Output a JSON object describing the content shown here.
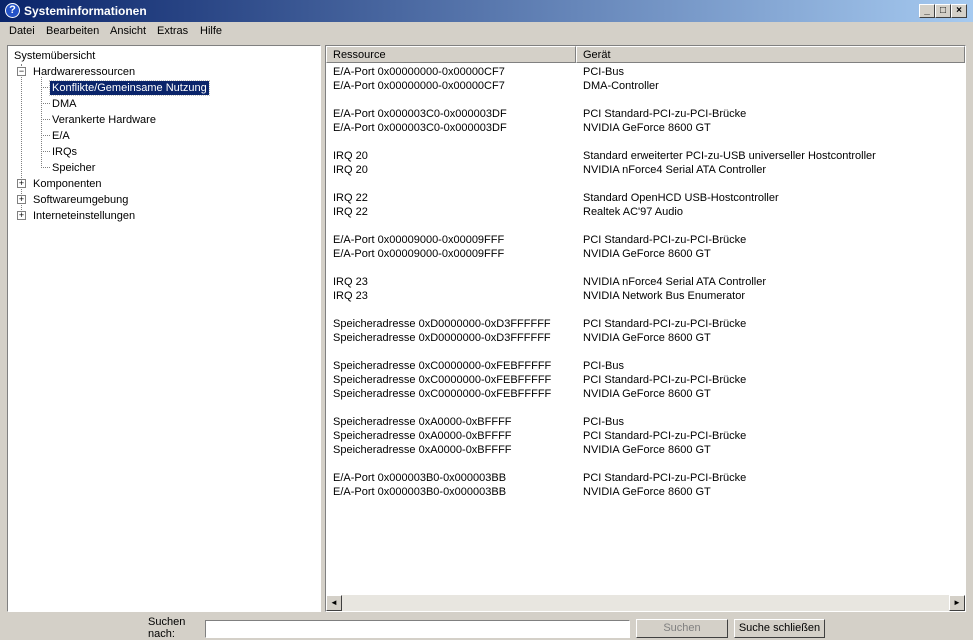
{
  "window": {
    "title": "Systeminformationen"
  },
  "window_buttons": [
    "_",
    "□",
    "×"
  ],
  "menu": [
    {
      "label": "Datei"
    },
    {
      "label": "Bearbeiten"
    },
    {
      "label": "Ansicht"
    },
    {
      "label": "Extras"
    },
    {
      "label": "Hilfe"
    }
  ],
  "tree": {
    "root": "Systemübersicht",
    "hardware": "Hardwareressourcen",
    "hardware_children": [
      "Konflikte/Gemeinsame Nutzung",
      "DMA",
      "Verankerte Hardware",
      "E/A",
      "IRQs",
      "Speicher"
    ],
    "others": [
      "Komponenten",
      "Softwareumgebung",
      "Interneteinstellungen"
    ],
    "expanded_glyph": "−",
    "collapsed_glyph": "+"
  },
  "list": {
    "columns": [
      "Ressource",
      "Gerät"
    ],
    "rows": [
      [
        "E/A-Port 0x00000000-0x00000CF7",
        "PCI-Bus"
      ],
      [
        "E/A-Port 0x00000000-0x00000CF7",
        "DMA-Controller"
      ],
      [
        "",
        ""
      ],
      [
        "E/A-Port 0x000003C0-0x000003DF",
        "PCI Standard-PCI-zu-PCI-Brücke"
      ],
      [
        "E/A-Port 0x000003C0-0x000003DF",
        "NVIDIA GeForce 8600 GT"
      ],
      [
        "",
        ""
      ],
      [
        "IRQ 20",
        "Standard erweiterter PCI-zu-USB universeller Hostcontroller"
      ],
      [
        "IRQ 20",
        "NVIDIA nForce4 Serial ATA Controller"
      ],
      [
        "",
        ""
      ],
      [
        "IRQ 22",
        "Standard OpenHCD USB-Hostcontroller"
      ],
      [
        "IRQ 22",
        "Realtek AC'97 Audio"
      ],
      [
        "",
        ""
      ],
      [
        "E/A-Port 0x00009000-0x00009FFF",
        "PCI Standard-PCI-zu-PCI-Brücke"
      ],
      [
        "E/A-Port 0x00009000-0x00009FFF",
        "NVIDIA GeForce 8600 GT"
      ],
      [
        "",
        ""
      ],
      [
        "IRQ 23",
        "NVIDIA nForce4 Serial ATA Controller"
      ],
      [
        "IRQ 23",
        "NVIDIA Network Bus Enumerator"
      ],
      [
        "",
        ""
      ],
      [
        "Speicheradresse 0xD0000000-0xD3FFFFFF",
        "PCI Standard-PCI-zu-PCI-Brücke"
      ],
      [
        "Speicheradresse 0xD0000000-0xD3FFFFFF",
        "NVIDIA GeForce 8600 GT"
      ],
      [
        "",
        ""
      ],
      [
        "Speicheradresse 0xC0000000-0xFEBFFFFF",
        "PCI-Bus"
      ],
      [
        "Speicheradresse 0xC0000000-0xFEBFFFFF",
        "PCI Standard-PCI-zu-PCI-Brücke"
      ],
      [
        "Speicheradresse 0xC0000000-0xFEBFFFFF",
        "NVIDIA GeForce 8600 GT"
      ],
      [
        "",
        ""
      ],
      [
        "Speicheradresse 0xA0000-0xBFFFF",
        "PCI-Bus"
      ],
      [
        "Speicheradresse 0xA0000-0xBFFFF",
        "PCI Standard-PCI-zu-PCI-Brücke"
      ],
      [
        "Speicheradresse 0xA0000-0xBFFFF",
        "NVIDIA GeForce 8600 GT"
      ],
      [
        "",
        ""
      ],
      [
        "E/A-Port 0x000003B0-0x000003BB",
        "PCI Standard-PCI-zu-PCI-Brücke"
      ],
      [
        "E/A-Port 0x000003B0-0x000003BB",
        "NVIDIA GeForce 8600 GT"
      ]
    ]
  },
  "scroll": {
    "left_arrow": "◄",
    "right_arrow": "►"
  },
  "search": {
    "label": "Suchen nach:",
    "value": "",
    "search_button": "Suchen",
    "close_button": "Suche schließen"
  },
  "colors": {
    "title_start": "#0a246a",
    "title_end": "#a6caf0",
    "selection": "#0a246a",
    "face": "#d4d0c8"
  }
}
